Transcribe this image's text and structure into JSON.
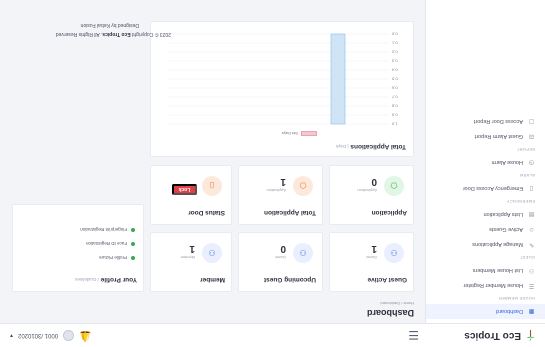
{
  "app": {
    "name": "Eco Tropics",
    "user": "0001 /3010202"
  },
  "sidebar": {
    "items": [
      {
        "label": "Dashboard",
        "icon": "grid-icon"
      },
      {
        "section": "HOUSE MEMBER"
      },
      {
        "label": "House Member Register",
        "icon": "list-icon"
      },
      {
        "label": "List House Members",
        "icon": "people-icon"
      },
      {
        "section": "GUEST"
      },
      {
        "label": "Manage Applications",
        "icon": "edit-icon"
      },
      {
        "label": "Active Guests",
        "icon": "user-icon"
      },
      {
        "label": "Lists Application",
        "icon": "document-icon"
      },
      {
        "section": "EMERGENCY"
      },
      {
        "label": "Emergency Access Door",
        "icon": "door-icon"
      },
      {
        "section": "ALARM"
      },
      {
        "label": "House Alarm",
        "icon": "alarm-icon"
      },
      {
        "section": "REPORT"
      },
      {
        "label": "Guest Alarm Report",
        "icon": "report-icon"
      },
      {
        "label": "Access Door Report",
        "icon": "report-icon"
      }
    ]
  },
  "page": {
    "title": "Dashboard",
    "breadcrumb": "Home / Dashboard"
  },
  "cards": {
    "guest_active": {
      "title": "Guest Active",
      "label": "Guest",
      "value": "1"
    },
    "upcoming_guest": {
      "title": "Upcoming Guest",
      "label": "Guest",
      "value": "0"
    },
    "member": {
      "title": "Member",
      "label": "Member",
      "value": "1"
    },
    "application": {
      "title": "Application",
      "label": "Application",
      "value": "0"
    },
    "total_application": {
      "title": "Total Application",
      "label": "Application",
      "value": "1"
    },
    "status_door": {
      "title": "Status Door",
      "button": "Lock"
    },
    "profile": {
      "title": "Your Profile",
      "subtitle": "/ Guidelines",
      "items": [
        "Profile Picture",
        "Face ID Registration",
        "Fingerprint Registration"
      ]
    }
  },
  "chart_data": {
    "type": "bar",
    "title": "Total Applications",
    "subtitle": "| Days",
    "series": [
      {
        "name": "Set Days",
        "values": [
          1
        ]
      }
    ],
    "categories": [
      ""
    ],
    "yticks": [
      "1.0",
      "0.9",
      "0.8",
      "0.7",
      "0.6",
      "0.5",
      "0.4",
      "0.3",
      "0.2",
      "0.1",
      "0.0"
    ],
    "ylim": [
      0,
      1
    ],
    "color": "#cfe4f7",
    "border_color": "#8dbde6"
  },
  "footer": {
    "copyright_prefix": "2023 © Copyright",
    "copyright_brand": "Eco Tropics",
    "copyright_suffix": ". All Rights Reserved",
    "developed": "Designed by Kebal Fusion"
  }
}
